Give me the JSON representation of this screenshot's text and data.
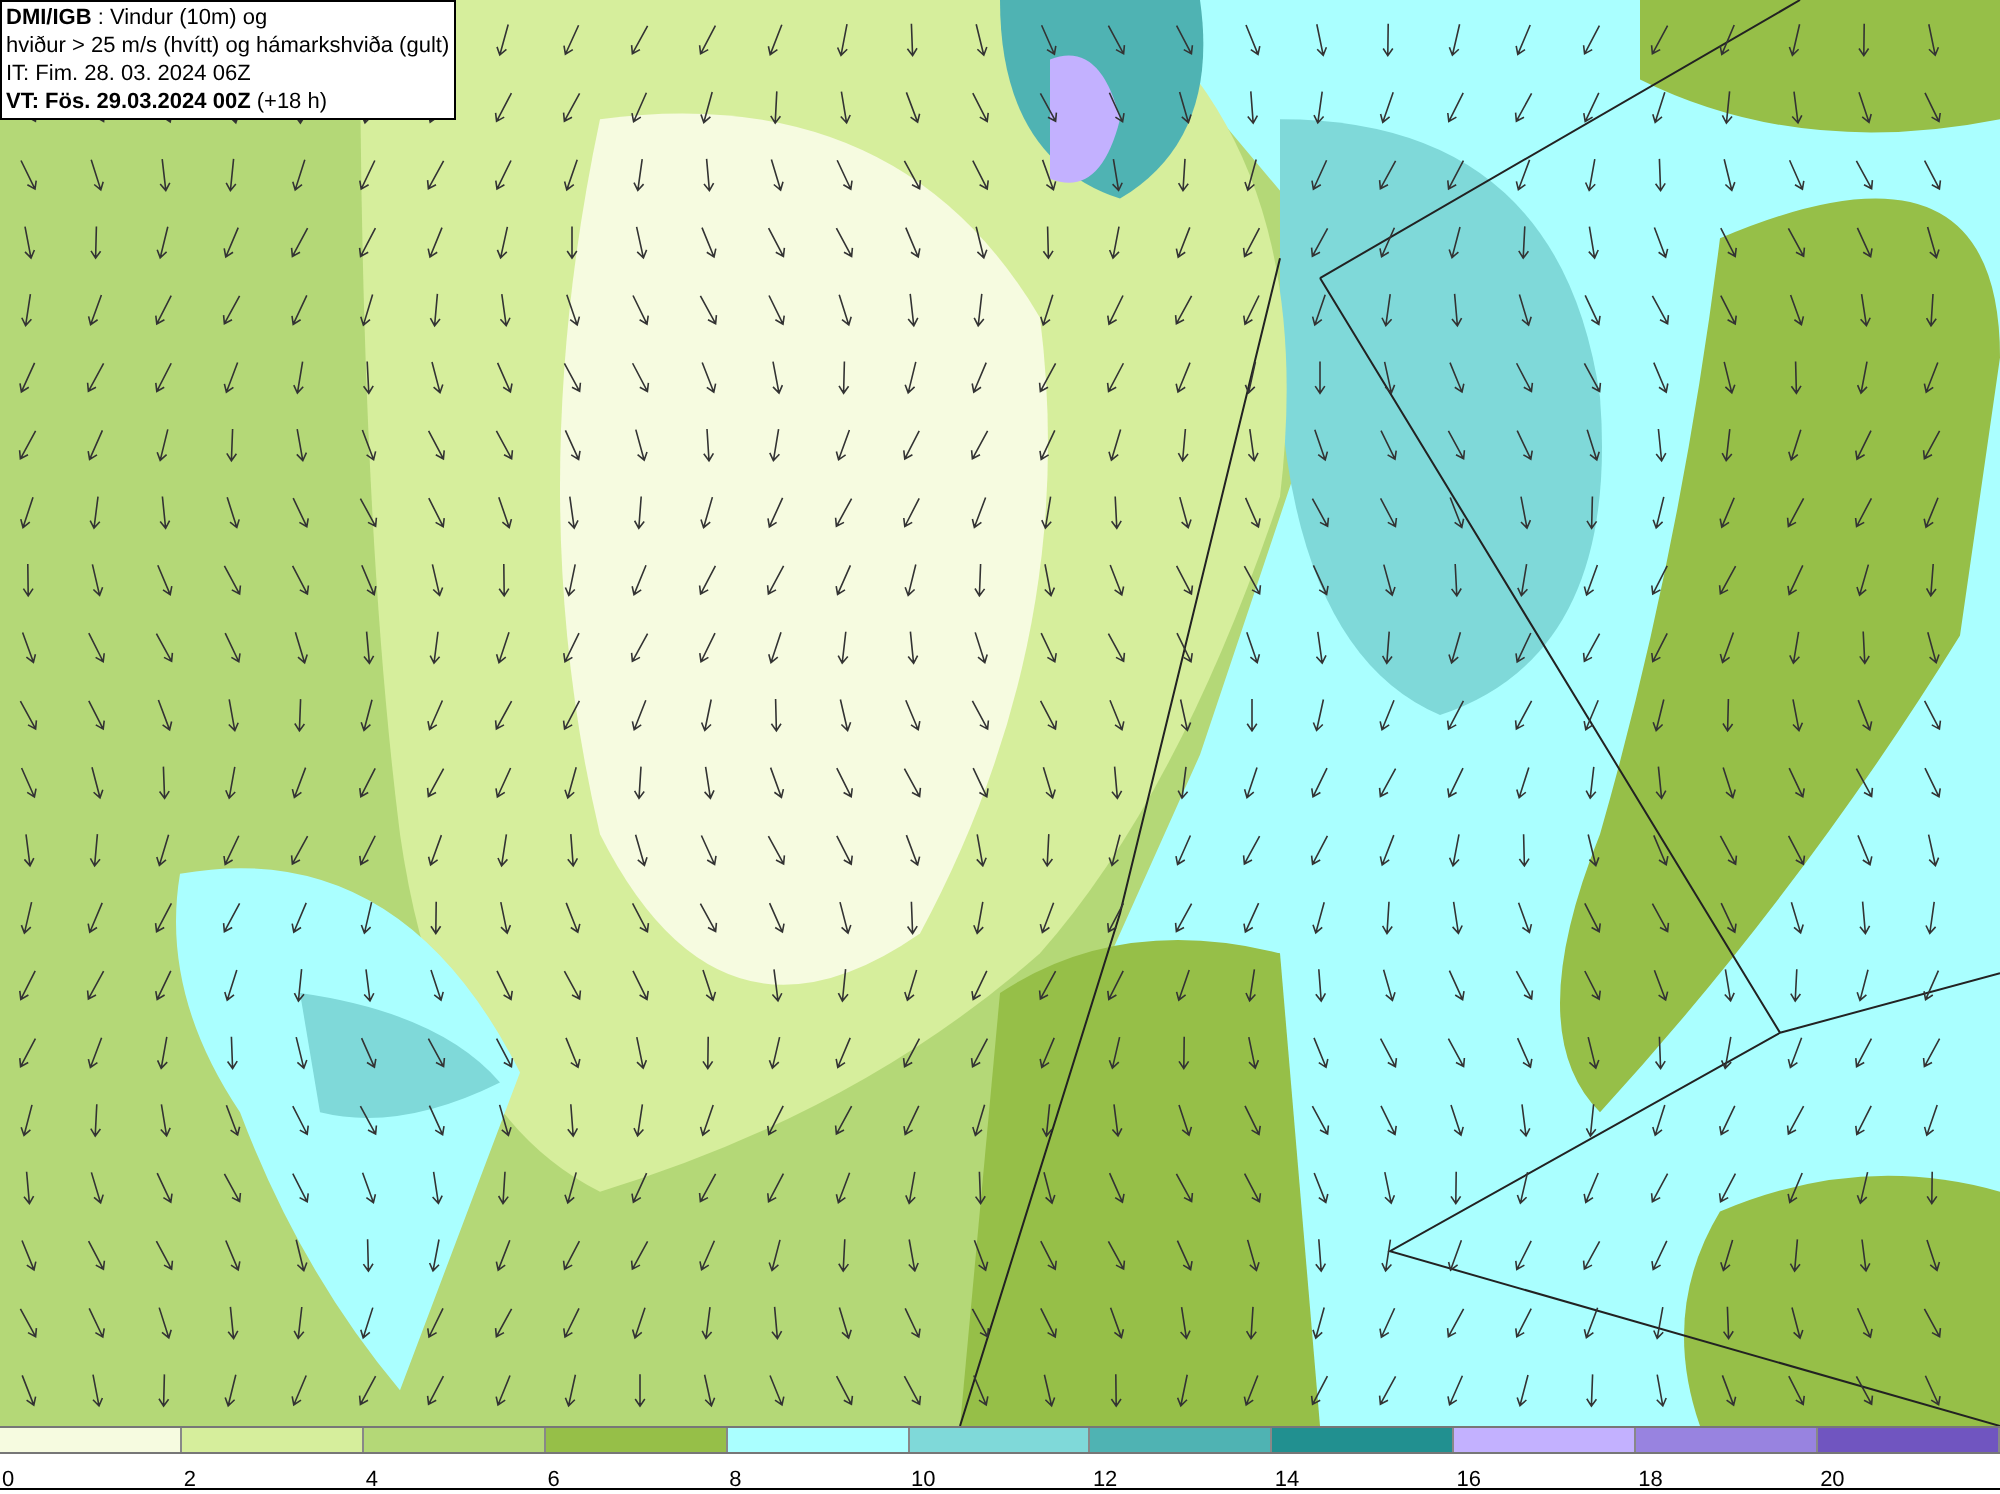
{
  "header": {
    "lines": [
      "**DMI/IGB** : Vindur (10m) og",
      "hviður > 25 m/s (hvítt) og hámarkshviða (gult)",
      "IT: Fim. 28. 03. 2024 06Z",
      "**VT: Fös. 29.03.2024 00Z** (+18 h)"
    ]
  },
  "legend": [
    {
      "label": "0",
      "color": "#f6fbe0"
    },
    {
      "label": "2",
      "color": "#d6ee9c"
    },
    {
      "label": "4",
      "color": "#b4d877"
    },
    {
      "label": "6",
      "color": "#96bf48"
    },
    {
      "label": "8",
      "color": "#aaffff"
    },
    {
      "label": "10",
      "color": "#7fd9d9"
    },
    {
      "label": "12",
      "color": "#4fb3b3"
    },
    {
      "label": "14",
      "color": "#219090"
    },
    {
      "label": "16",
      "color": "#c3b1ff"
    },
    {
      "label": "18",
      "color": "#9883e0"
    },
    {
      "label": "20",
      "color": "#7055c0"
    }
  ]
}
